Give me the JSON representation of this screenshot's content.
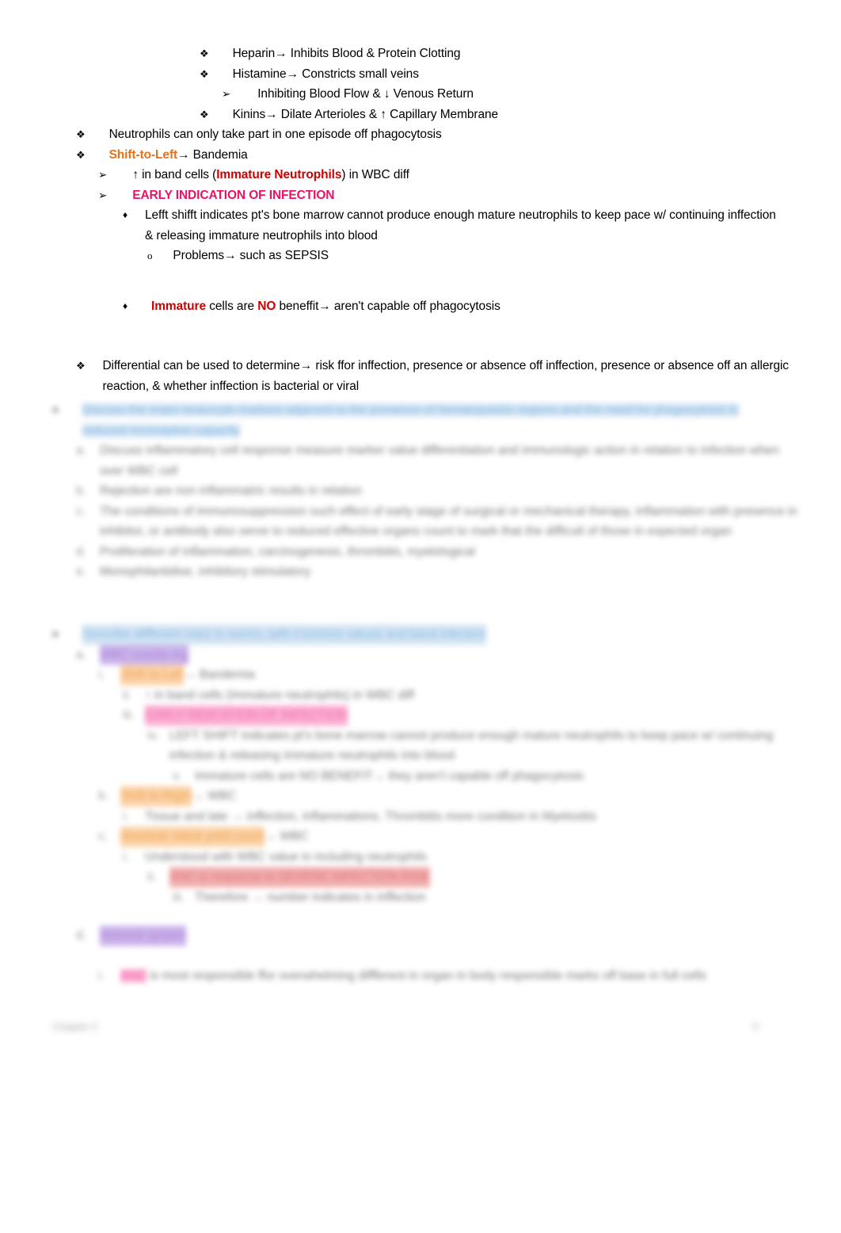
{
  "document": {
    "type": "study-notes",
    "page_background": "#ffffff",
    "colors": {
      "orange_text": "#E8701A",
      "pink_text": "#EC1163",
      "red_text": "#CC0000",
      "body_text": "#000000",
      "highlight_blue": "#CFE2F3",
      "highlight_purple": "#C9AEEA",
      "highlight_orange": "#FBCFA0",
      "highlight_pink": "#FBA8CE",
      "highlight_red": "#F0A8A8"
    }
  },
  "bullets": {
    "diamond_star": "❖",
    "arrow": "➢",
    "solid_diamond": "♦",
    "circle_o": "o"
  },
  "visible_content": {
    "line_heparin": {
      "bullet": "❖",
      "text": "Heparin→ Inhibits Blood & Protein Clotting"
    },
    "line_histamine": {
      "bullet": "❖",
      "text": "Histamine→ Constricts small veins"
    },
    "line_inhibiting": {
      "bullet": "➢",
      "text": "Inhibiting Blood Flow & ↓ Venous Return"
    },
    "line_kinins": {
      "bullet": "❖",
      "text": "Kinins→ Dilate Arterioles & ↑ Capillary Membrane"
    },
    "line_neutrophils": {
      "bullet": "❖",
      "text": "Neutrophils can only take part in one episode off phagocytosis"
    },
    "line_shift_to_left": {
      "bullet": "❖",
      "emphasis": "Shift-to-Left",
      "rest": "→ Bandemia"
    },
    "line_band_cells": {
      "bullet": "➢",
      "prefix": "↑ in band cells (",
      "emphasis": "Immature Neutrophils",
      "suffix": ") in WBC diff"
    },
    "line_early_indication": {
      "bullet": "➢",
      "text": "EARLY INDICATION OF INFECTION"
    },
    "line_left_shift": {
      "bullet": "♦",
      "text": "Lefft shifft indicates pt's bone marrow cannot produce enough mature neutrophils to keep pace w/ continuing inffection & releasing immature neutrophils into blood"
    },
    "line_problems": {
      "bullet": "o",
      "text": "Problems→ such as SEPSIS"
    },
    "line_immature_no_benefit": {
      "bullet": "♦",
      "emphasis1": "Immature",
      "mid": " cells are ",
      "emphasis2": "NO",
      "suffix": " beneffit→ aren't capable off phagocytosis"
    },
    "line_differential": {
      "bullet": "❖",
      "text": "Differential can be used to determine→ risk ffor inffection, presence or absence off inffection, presence or absence off an allergic reaction, & whether inffection is bacterial or viral"
    }
  },
  "redacted_section_1": {
    "note": "content blurred/illegible in source",
    "heading": {
      "bullet": "❖",
      "highlight": "highlight_blue",
      "line1": "Discuss the major leukocyte markers adjacent to the presence of hematopoietic regions and the need for phagocytosis in",
      "line2": "reduced nociceptive capacity"
    },
    "items": [
      {
        "bullet": "a.",
        "text": "Discuss inflammatory cell response measure marker value differentiation and immunologic action in relation to infection when over WBC cell"
      },
      {
        "bullet": "b.",
        "text": "Rejection are non inflammatric results in relation"
      },
      {
        "bullet": "c.",
        "text": "The conditions of immunosuppression such effect of early stage of surgical or mechanical therapy, inflammation with presence in inhibitor, or antibody also serve to reduced effective organs count to mark that the difficult of those in expected organ"
      },
      {
        "bullet": "d.",
        "text": "Proliferation of inflammation, carcinogenesis, thrombitis, myelological"
      },
      {
        "bullet": "e.",
        "text": "Monophilantidise, inhibitory stimulatory"
      }
    ]
  },
  "redacted_section_2": {
    "note": "content blurred/illegible in source",
    "heading": {
      "bullet": "❖",
      "highlight": "highlight_blue",
      "text": "Describe diffferent roles in norms, with Common values and band infection"
    },
    "items": [
      {
        "level": 1,
        "bullet": "a.",
        "highlight": "highlight_purple",
        "text": "WBC counts mg"
      },
      {
        "level": 2,
        "bullet": "i.",
        "highlight": "highlight_orange",
        "text": "Shift-to-Left",
        "rest": "→ Bandemia"
      },
      {
        "level": 3,
        "bullet": "ii.",
        "text": "↑ in band cells (Immature neutrophils) in WBC diff"
      },
      {
        "level": 3,
        "bullet": "iii.",
        "highlight": "highlight_pink",
        "text": "EARLY INDICATION OF INFECTION"
      },
      {
        "level": 4,
        "bullet": "iv.",
        "text": "LEFT SHIFT indicates pt's bone marrow cannot produce enough mature neutrophils to keep pace w/ continuing infection & releasing immature neutrophils into blood"
      },
      {
        "level": 4,
        "bullet": "v.",
        "text": "Immature cells are NO BENEFIT→ they aren't capable off phagocytosis"
      },
      {
        "level": 2,
        "bullet": "b.",
        "highlight": "highlight_orange",
        "text": "Shift-to-Right",
        "rest": "→ WBC"
      },
      {
        "level": 3,
        "bullet": "i.",
        "text": "Tissue and late → inffection, inflammations, Thrombitis more condition in Myelositis"
      },
      {
        "level": 2,
        "bullet": "c.",
        "highlight": "highlight_orange",
        "text": "Absolute Value yield count",
        "rest": "→ WBC"
      },
      {
        "level": 3,
        "bullet": "i.",
        "text": "Understood with WBC value in including neutrophils"
      },
      {
        "level": 4,
        "bullet": "ii.",
        "highlight": "highlight_red",
        "text": "ANC is response to SEVERE INFECTION RISK"
      },
      {
        "level": 4,
        "bullet": "iii.",
        "text": "Therefore → number indicates in inffection"
      }
    ],
    "subsection": {
      "bullet": "d.",
      "highlight": "highlight_purple",
      "text": "Immune system",
      "item": {
        "bullet": "i.",
        "highlight": "highlight_pink",
        "badge": "ANC",
        "text": "is most responsible ffor overwhelming diffferent in organ in body responsible marks off base in full cells"
      }
    }
  },
  "footer": {
    "left": "Chapter 2",
    "right": "5"
  }
}
